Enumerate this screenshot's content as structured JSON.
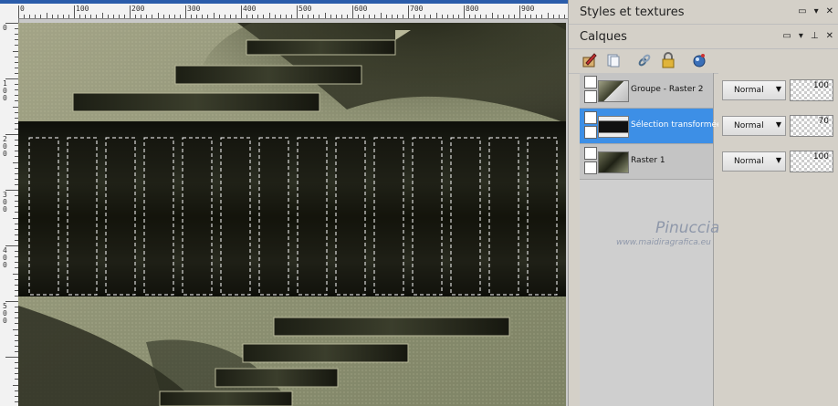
{
  "rulers": {
    "horizontal": [
      "0",
      "100",
      "200",
      "300",
      "400",
      "500",
      "600",
      "700",
      "800",
      "900"
    ],
    "vertical": [
      "0",
      "100",
      "200",
      "300",
      "400",
      "500"
    ]
  },
  "panels": {
    "styles": {
      "title": "Styles et textures"
    },
    "layers": {
      "title": "Calques"
    }
  },
  "layers": [
    {
      "name": "Groupe - Raster 2",
      "blend_mode": "Normal",
      "opacity": "100",
      "selected": false
    },
    {
      "name": "Sélection transformée",
      "blend_mode": "Normal",
      "opacity": "70",
      "selected": true
    },
    {
      "name": "Raster 1",
      "blend_mode": "Normal",
      "opacity": "100",
      "selected": false
    }
  ],
  "watermark": {
    "name": "Pinuccia",
    "url": "www.maidiragrafica.eu"
  },
  "colors": {
    "selection": "#3d8fe6",
    "canvas_bg": "#c9c9c9",
    "image_tone": "#8e9274"
  }
}
